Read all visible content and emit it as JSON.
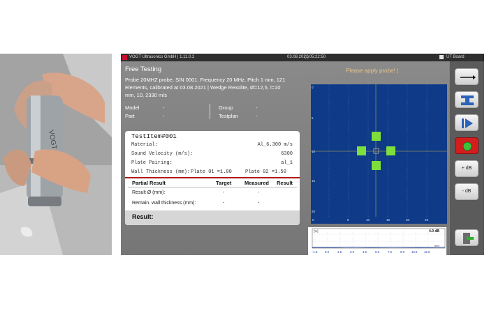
{
  "window": {
    "title": "VOGT Ultrasonics GmbH | 1.11.0.2",
    "datetime": "03.08.2021 05:22:50",
    "status_symbol": "(-)",
    "board": "UT Board"
  },
  "header": {
    "mode": "Free Testing",
    "probe_info": [
      "Probe 20MHZ probe, S/N 0001, Frequency 20 MHz, Pitch 1 mm, 121",
      "Elements, calibrated at 03.08.2021 | Wedge Rexolite, Ø=12,5, l=10",
      "mm, 10, 2330 m/s"
    ],
    "model_label": "Model",
    "model_value": "-",
    "part_label": "Part",
    "part_value": "-",
    "group_label": "Group",
    "group_value": "-",
    "testplan_label": "Testplan",
    "testplan_value": "-",
    "prompt": "Please apply probe!"
  },
  "test_item": {
    "title": "TestItem#001",
    "rows": [
      {
        "label": "Material:",
        "value": "Al_6.300 m/s"
      },
      {
        "label": "Sound Velocity (m/s):",
        "value": "6300"
      },
      {
        "label": "Plate Pairing:",
        "value": "al_1"
      }
    ],
    "wall_label": "Wall Thickness (mm):",
    "plate1": "Plate 01 =1.00",
    "plate2": "Plate 02 =1.50"
  },
  "results_table": {
    "headers": [
      "Partial Result",
      "Target",
      "Measured",
      "Result"
    ],
    "rows": [
      {
        "name": "Result Ø (mm):",
        "target": "-",
        "measured": "-",
        "result": ""
      },
      {
        "name": "Remain. wall thickness (mm):",
        "target": "-",
        "measured": "-",
        "result": ""
      }
    ],
    "result_label": "Result:"
  },
  "graph": {
    "y_label": "[%]",
    "db": "4.0 dB",
    "x_unit": "mm",
    "x_ticks": [
      "-1.5",
      "0.0",
      "1.5",
      "3.0",
      "4.5",
      "6.0",
      "7.5",
      "9.0",
      "10.5",
      "12.0"
    ]
  },
  "ascan": {
    "x_ticks": [
      "0",
      "5",
      "10",
      "15",
      "20",
      "25"
    ],
    "y_ticks": [
      "0",
      "5",
      "10",
      "15",
      "20"
    ]
  },
  "sidebar": {
    "plus_db": "+ dB",
    "minus_db": "- dB"
  },
  "colors": {
    "ascan_bg": "#0e3a87",
    "marker": "#7dde3c",
    "prompt": "#e8c48a",
    "record": "#c8102e"
  },
  "icons": [
    "arrow-right-icon",
    "beam-icon",
    "play-step-icon",
    "record-icon",
    "exit-icon",
    "vogt-logo-icon"
  ]
}
